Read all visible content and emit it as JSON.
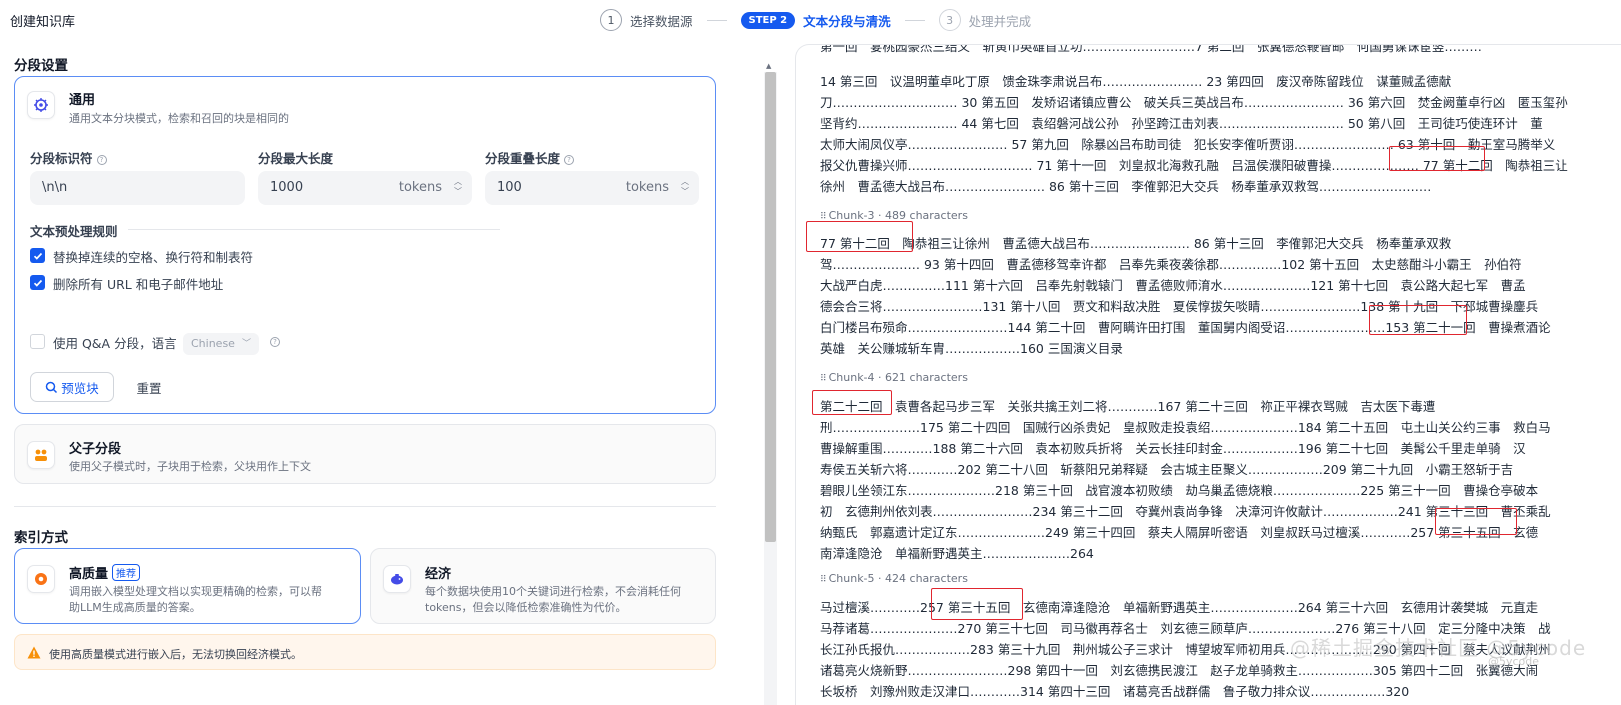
{
  "header": {
    "title": "创建知识库",
    "steps": [
      {
        "num": "1",
        "label": "选择数据源"
      },
      {
        "pill": "STEP 2",
        "label": "文本分段与清洗"
      },
      {
        "num": "3",
        "label": "处理并完成"
      }
    ]
  },
  "left": {
    "segment_section_title": "分段设置",
    "general": {
      "title": "通用",
      "desc": "通用文本分块模式，检索和召回的块是相同的"
    },
    "fields": {
      "separator": {
        "label": "分段标识符",
        "value": "\\n\\n"
      },
      "max_length": {
        "label": "分段最大长度",
        "value": "1000",
        "unit": "tokens"
      },
      "overlap": {
        "label": "分段重叠长度",
        "value": "100",
        "unit": "tokens"
      }
    },
    "preprocess_title": "文本预处理规则",
    "rules": [
      {
        "label": "替换掉连续的空格、换行符和制表符",
        "checked": true
      },
      {
        "label": "删除所有 URL 和电子邮件地址",
        "checked": true
      }
    ],
    "qa": {
      "label": "使用 Q&A 分段，语言",
      "language": "Chinese",
      "checked": false
    },
    "preview_button": "预览块",
    "reset_button": "重置",
    "parent_child": {
      "title": "父子分段",
      "desc": "使用父子模式时，子块用于检索，父块用作上下文"
    },
    "index_section_title": "索引方式",
    "high_quality": {
      "title": "高质量",
      "badge": "推荐",
      "desc_line1": "调用嵌入模型处理文档以实现更精确的检索，可以帮",
      "desc_line2": "助LLM生成高质量的答案。"
    },
    "economy": {
      "title": "经济",
      "desc_line1": "每个数据块使用10个关键词进行检索，不会消耗任何",
      "desc_line2": "tokens，但会以降低检索准确性为代价。"
    },
    "warning": "使用高质量模式进行嵌入后，无法切换回经济模式。"
  },
  "preview": {
    "top_lines": [
      "第一回　宴桃园豪杰三结义　斩黄巾英雄首立功………………………7 第二回　张翼德怒鞭督邮　何国舅谋诛宦竖………",
      "14 第三回　议温明董卓叱丁原　馈金珠李肃说吕布…………………… 23 第四回　废汉帝陈留践位　谋董贼孟德献",
      "刀………………………… 30 第五回　发矫诏诸镇应曹公　破关兵三英战吕布…………………… 36 第六回　焚金阙董卓行凶　匿玉玺孙",
      "坚背约…………………… 44 第七回　袁绍磐河战公孙　孙坚跨江击刘表………………………… 50 第八回　王司徒巧使连环计　董",
      "太师大闹凤仪亭…………………… 57 第九回　除暴凶吕布助司徒　犯长安李傕听贾诩…………………… 63 第十回　勤王室马腾举义",
      "报父仇曹操兴师………………………… 71 第十一回　刘皇叔北海救孔融　吕温侯濮阳破曹操………………… 77 第十二回　陶恭祖三让",
      "徐州　曹孟德大战吕布…………………… 86 第十三回　李傕郭汜大交兵　杨奉董承双救驾………………………"
    ],
    "chunks": [
      {
        "label": "Chunk-3",
        "chars": "489 characters",
        "lines": [
          "77 第十二回　陶恭祖三让徐州　曹孟德大战吕布…………………… 86 第十三回　李傕郭汜大交兵　杨奉董承双救",
          "驾………………… 93 第十四回　曹孟德移驾幸许都　吕奉先乘夜袭徐郡……………102 第十五回　太史慈酣斗小霸王　孙伯符",
          "大战严白虎……………111 第十六回　吕奉先射戟辕门　曹孟德败师淯水…………………121 第十七回　袁公路大起七军　曹孟",
          "德会合三将……………………131 第十八回　贾文和料敌决胜　夏侯惇拔矢啖睛……………………138 第十九回　下邳城曹操鏖兵",
          "白门楼吕布殒命……………………144 第二十回　曹阿瞒许田打围　董国舅内阁受诏……………………153 第二十一回　曹操煮酒论",
          "英雄　关公赚城斩车胄………………160 三国演义目录"
        ]
      },
      {
        "label": "Chunk-4",
        "chars": "621 characters",
        "lines": [
          "第二十二回　袁曹各起马步三军　关张共擒王刘二将…………167 第二十三回　祢正平裸衣骂贼　吉太医下毒遭",
          "刑…………………175 第二十四回　国贼行凶杀贵妃　皇叔败走投袁绍…………………184 第二十五回　屯土山关公约三事　救白马",
          "曹操解重围…………188 第二十六回　袁本初败兵折将　关云长挂印封金………………196 第二十七回　美髯公千里走单骑　汉",
          "寿侯五关斩六将…………202 第二十八回　斩蔡阳兄弟释疑　会古城主臣聚义………………209 第二十九回　小霸王怒斩于吉",
          "碧眼儿坐领江东…………………218 第三十回　战官渡本初败绩　劫乌巢孟德烧粮…………………225 第三十一回　曹操仓亭破本",
          "初　玄德荆州依刘表……………………234 第三十二回　夺冀州袁尚争锋　决漳河许攸献计………………241 第三十三回　曹丕乘乱",
          "纳甄氏　郭嘉遗计定辽东…………………249 第三十四回　蔡夫人隔屏听密语　刘皇叔跃马过檀溪…………257 第三十五回　玄德",
          "南漳逢隐沧　单福新野遇英主…………………264"
        ]
      },
      {
        "label": "Chunk-5",
        "chars": "424 characters",
        "lines": [
          "马过檀溪…………257 第三十五回　玄德南漳逢隐沧　单福新野遇英主…………………264 第三十六回　玄德用计袭樊城　元直走",
          "马荐诸葛…………………270 第三十七回　司马徽再荐名士　刘玄德三顾草庐…………………276 第三十八回　定三分隆中决策　战",
          "长江孙氏报仇………………283 第三十九回　荆州城公子三求计　博望坡军师初用兵…………………290 第四十回　蔡夫人议献荆州",
          "诸葛亮火烧新野……………………298 第四十一回　刘玄德携民渡江　赵子龙单骑救主………………305 第四十二回　张翼德大闹",
          "长坂桥　刘豫州败走汉津口…………314 第四十三回　诸葛亮舌战群儒　鲁子敬力排众议………………320"
        ]
      }
    ]
  },
  "watermark": "@稀土掘金技术社区 @5ycode",
  "watermark_small": "@5ycode"
}
